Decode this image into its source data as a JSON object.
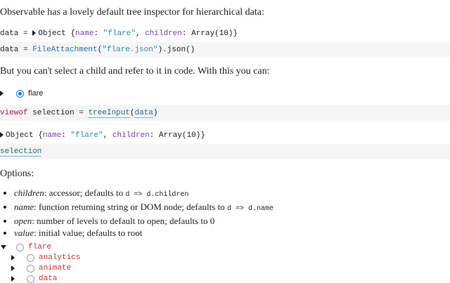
{
  "intro": "Observable has a lovely default tree inspector for hierarchical data:",
  "cell1": {
    "var": "data",
    "eq": " = ",
    "obj": "Object",
    "brace_open": " {",
    "k1": "name",
    "colon": ": ",
    "v1": "\"flare\"",
    "comma": ", ",
    "k2": "children",
    "v2": "Array(10)",
    "brace_close": "}"
  },
  "cell2": {
    "var": "data",
    "eq": " = ",
    "fn": "FileAttachment",
    "paren_open": "(",
    "str": "\"flare.json\"",
    "rest": ").json()"
  },
  "para2": "But you can't select a child and refer to it in code. With this you can:",
  "preview_label": "flare",
  "cell3": {
    "kw": "viewof",
    "var": " selection",
    "eq": " = ",
    "fn": "treeInput",
    "paren_open": "(",
    "arg": "data",
    "paren_close": ")"
  },
  "output": {
    "obj": "Object",
    "brace_open": " {",
    "k1": "name",
    "colon": ": ",
    "v1": "\"flare\"",
    "comma": ", ",
    "k2": "children",
    "v2": "Array(10)",
    "brace_close": "}"
  },
  "cell4": "selection",
  "options_heading": "Options:",
  "options": [
    {
      "name": "children",
      "text": ": accessor; defaults to ",
      "code": "d => d.children"
    },
    {
      "name": "name",
      "text": ": function returning string or DOM node; defaults to ",
      "code": "d => d.name"
    },
    {
      "name": "open",
      "text": ": number of levels to default to open; defaults to 0",
      "code": ""
    },
    {
      "name": "value",
      "text": ": initial value; defaults to root",
      "code": ""
    }
  ],
  "tree": {
    "root": "flare",
    "children": [
      "analytics",
      "animate",
      "data"
    ]
  },
  "colors": {
    "cell_bg": "#f5f5f5",
    "keyword": "#a8195d",
    "function": "#1f6fb5",
    "string": "#2a89b5",
    "key": "#7a3fb0",
    "tree_label": "#c0392b",
    "radio_selected": "#1a73e8"
  }
}
